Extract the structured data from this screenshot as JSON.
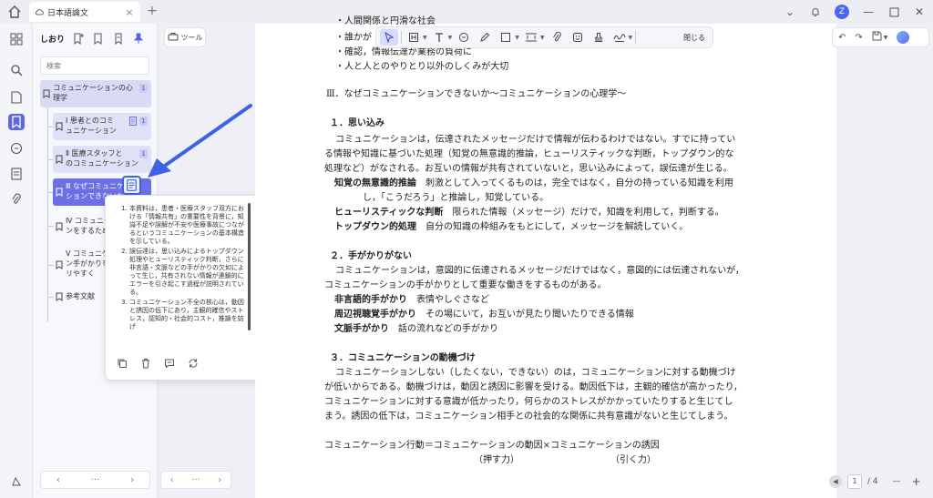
{
  "titlebar": {
    "tab_title": "日本語論文",
    "avatar_letter": "Z"
  },
  "sidebar": {
    "title": "しおり",
    "search_placeholder": "検索",
    "bookmarks": [
      {
        "label_1": "コミュニケーションの心",
        "label_2": "理学",
        "count": "1"
      },
      {
        "label_1": "Ⅰ 患者とのコミ",
        "label_2": "ュニケーション",
        "count": "1"
      },
      {
        "label_1": "Ⅱ 医療スタッフと",
        "label_2": "のコミュニケーション",
        "count": "1"
      },
      {
        "label_1": "Ⅲ なぜコミュニケー",
        "label_2": "ションできないか"
      },
      {
        "label_1": "Ⅳ コミュニケー",
        "label_2": "ンをするため"
      },
      {
        "label_1": "Ⅴ コミュニケー",
        "label_2": "ン手がかりを",
        "label_3": "リやすく"
      },
      {
        "label_1": "参考文献"
      }
    ]
  },
  "popup": {
    "items": [
      "本資料は，患者・医療スタッフ双方における「情報共有」の重要性を背景に，知識不足や誤解が不安や医療事故につながるというコミュニケーションの基本構造を示している。",
      "誤伝達は，思い込みによるトップダウン処理やヒューリスティック判断，さらに非言語・文脈などの手がかりの欠如によって生じ，共有されない情報が連鎖的にエラーを引き起こす過程が説明されている。",
      "コミュニケーション不全の核心は，動因と誘因の低下にあり，主観的確信やストレス，認知的・社会的コスト，推論を妨げ"
    ]
  },
  "toolbar": {
    "tools_label": "ツール",
    "close_label": "閉じる"
  },
  "doc": {
    "bullet_top": "・人間関係と円滑な社会",
    "bullet_1": "・誰かが",
    "bullet_2": "・確認，情報伝達が業務の負荷に",
    "bullet_3": "・人と人とのやりとり以外のしくみが大切",
    "heading": "Ⅲ．なぜコミュニケーションできないか～コミュニケーションの心理学～",
    "s1_title": "１．思い込み",
    "s1_p1": "コミュニケーションは，伝達されたメッセージだけで情報が伝わるわけではない。すでに持ってい",
    "s1_p2": "る情報や知識に基づいた処理（知覚の無意識的推論，ヒューリスティックな判断，トップダウン的な",
    "s1_p3": "処理など）がなされる。お互いの情報が共有されていないと，思い込みによって，誤伝達が生じる。",
    "s1_t1": "知覚の無意識的推論",
    "s1_d1": "　刺激として入ってくるものは，完全ではなく，自分の持っている知識を利用",
    "s1_d1b": "し，「こうだろう」と推論し，知覚している。",
    "s1_t2": "ヒューリスティックな判断",
    "s1_d2": "　限られた情報（メッセージ）だけで，知識を利用して，判断する。",
    "s1_t3": "トップダウン的処理",
    "s1_d3": "　自分の知識の枠組みをもとにして，メッセージを解読していく。",
    "s2_title": "２．手がかりがない",
    "s2_p1": "コミュニケーションは，意図的に伝達されるメッセージだけではなく，意図的には伝達されないが，",
    "s2_p2": "コミュニケーションの手がかりとして重要な働きをするものがある。",
    "s2_t1": "非言語的手がかり",
    "s2_d1": "　表情やしぐさなど",
    "s2_t2": "周辺視聴覚手がかり",
    "s2_d2": "　その場にいて，お互いが見たり聞いたりできる情報",
    "s2_t3": "文脈手がかり",
    "s2_d3": "　話の流れなどの手がかり",
    "s3_title": "３．コミュニケーションの動機づけ",
    "s3_p1": "コミュニケーションしない（したくない，できない）のは，コミュニケーションに対する動機づけ",
    "s3_p2": "が低いからである。動機づけは，動因と誘因に影響を受ける。動因低下は，主観的確信が高かったり，",
    "s3_p3": "コミュニケーションに対する意識が低かったり，何らかのストレスがかかっていたりすると生じてし",
    "s3_p4": "まう。誘因の低下は，コミュニケーション相手との社会的な関係に共有意識がないと生じてしまう。",
    "formula": "コミュニケーション行動＝コミュニケーションの動因×コミュニケーションの誘因",
    "push": "（押す力）",
    "pull": "（引く力）"
  },
  "pager": {
    "current": "1",
    "total": "/ 4"
  },
  "colors": {
    "accent": "#5b67e8",
    "selected": "#6c70e6",
    "arrow": "#3d62e6"
  }
}
